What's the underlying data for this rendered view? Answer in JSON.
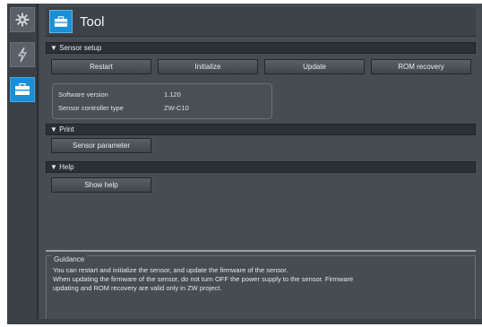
{
  "window": {
    "title": "Tool"
  },
  "sidebar": {
    "items": [
      {
        "icon": "gear-icon"
      },
      {
        "icon": "lightning-icon"
      },
      {
        "icon": "toolbox-icon",
        "active": true
      }
    ]
  },
  "sections": {
    "sensor_setup": {
      "header": "▼ Sensor setup",
      "buttons": [
        "Restart",
        "Initialize",
        "Update",
        "ROM recovery"
      ],
      "info": [
        {
          "label": "Software version",
          "value": "1.120"
        },
        {
          "label": "Sensor controller type",
          "value": "ZW-C10"
        }
      ]
    },
    "print": {
      "header": "▼ Print",
      "button": "Sensor parameter"
    },
    "help": {
      "header": "▼ Help",
      "button": "Show help"
    }
  },
  "guidance": {
    "title": "Guidance",
    "lines": [
      "You can restart and initialize the sensor, and update the firmware of the sensor.",
      "When updating the firmware of the sensor, do not turn OFF the power supply to the sensor. Firmware",
      "updating and ROM recovery are valid only in ZW project."
    ]
  },
  "colors": {
    "accent": "#1a8fd6",
    "panel": "#474c53",
    "header": "#2b3035"
  }
}
